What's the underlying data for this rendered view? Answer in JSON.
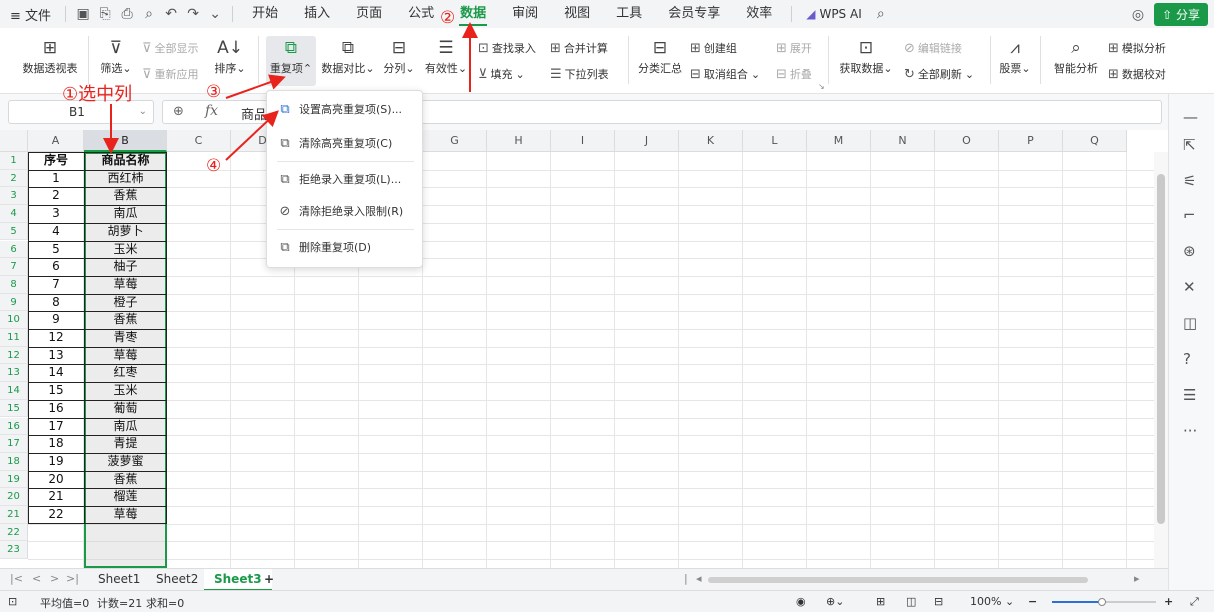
{
  "menubar": {
    "menu_icon": "≡",
    "file_label": "文件",
    "tabs": [
      "开始",
      "插入",
      "页面",
      "公式",
      "数据",
      "审阅",
      "视图",
      "工具",
      "会员专享",
      "效率"
    ],
    "active_tab": "数据",
    "wps_ai_label": "WPS AI",
    "share_label": "分享"
  },
  "ribbon": {
    "pivot": "数据透视表",
    "filter": "筛选",
    "show_all": "全部显示",
    "reapply": "重新应用",
    "sort": "排序",
    "duplicates": "重复项",
    "compare": "数据对比",
    "split": "分列",
    "validity": "有效性",
    "find_entry": "查找录入",
    "fill": "填充",
    "merge_calc": "合并计算",
    "dropdown_list": "下拉列表",
    "subtotal": "分类汇总",
    "create_group": "创建组",
    "ungroup": "取消组合",
    "expand": "展开",
    "collapse": "折叠",
    "get_data": "获取数据",
    "edit_links": "编辑链接",
    "refresh_all": "全部刷新",
    "stocks": "股票",
    "smart_analysis": "智能分析",
    "simulation": "模拟分析",
    "data_check": "数据校对"
  },
  "formula_bar": {
    "cell_ref": "B1",
    "fx_symbol": "fx",
    "value": "商品"
  },
  "columns": [
    "A",
    "B",
    "C",
    "D",
    "E",
    "F",
    "G",
    "H",
    "I",
    "J",
    "K",
    "L",
    "M",
    "N",
    "O",
    "P",
    "Q"
  ],
  "rows": [
    "1",
    "2",
    "3",
    "4",
    "5",
    "6",
    "7",
    "8",
    "9",
    "10",
    "11",
    "12",
    "13",
    "14",
    "15",
    "16",
    "17",
    "18",
    "19",
    "20",
    "21",
    "22",
    "23"
  ],
  "table": {
    "headers": [
      "序号",
      "商品名称"
    ],
    "rows": [
      [
        "1",
        "西红柿"
      ],
      [
        "2",
        "香蕉"
      ],
      [
        "3",
        "南瓜"
      ],
      [
        "4",
        "胡萝卜"
      ],
      [
        "5",
        "玉米"
      ],
      [
        "6",
        "柚子"
      ],
      [
        "7",
        "草莓"
      ],
      [
        "8",
        "橙子"
      ],
      [
        "9",
        "香蕉"
      ],
      [
        "12",
        "青枣"
      ],
      [
        "13",
        "草莓"
      ],
      [
        "14",
        "红枣"
      ],
      [
        "15",
        "玉米"
      ],
      [
        "16",
        "葡萄"
      ],
      [
        "17",
        "南瓜"
      ],
      [
        "18",
        "青提"
      ],
      [
        "19",
        "菠萝蜜"
      ],
      [
        "20",
        "香蕉"
      ],
      [
        "21",
        "榴莲"
      ],
      [
        "22",
        "草莓"
      ]
    ]
  },
  "dropdown_menu": {
    "items": [
      {
        "label": "设置高亮重复项(S)...",
        "icon": "highlight-duplicates-icon"
      },
      {
        "label": "清除高亮重复项(C)",
        "icon": "clear-highlight-icon"
      },
      {
        "label": "拒绝录入重复项(L)...",
        "icon": "reject-duplicates-icon"
      },
      {
        "label": "清除拒绝录入限制(R)",
        "icon": "clear-restriction-icon"
      },
      {
        "label": "删除重复项(D)",
        "icon": "delete-duplicates-icon"
      }
    ]
  },
  "sheets": {
    "tabs": [
      "Sheet1",
      "Sheet2",
      "Sheet3"
    ],
    "active": "Sheet3",
    "add_label": "+"
  },
  "statusbar": {
    "average": "平均值=0",
    "count": "计数=21",
    "sum": "求和=0",
    "zoom": "100%"
  },
  "annotations": {
    "step1": "①选中列",
    "step2": "②",
    "step3": "③",
    "step4": "④"
  },
  "colors": {
    "accent": "#1a9a49",
    "annotation": "#e8231c",
    "menu_icon_blue": "#2c6fd6"
  }
}
